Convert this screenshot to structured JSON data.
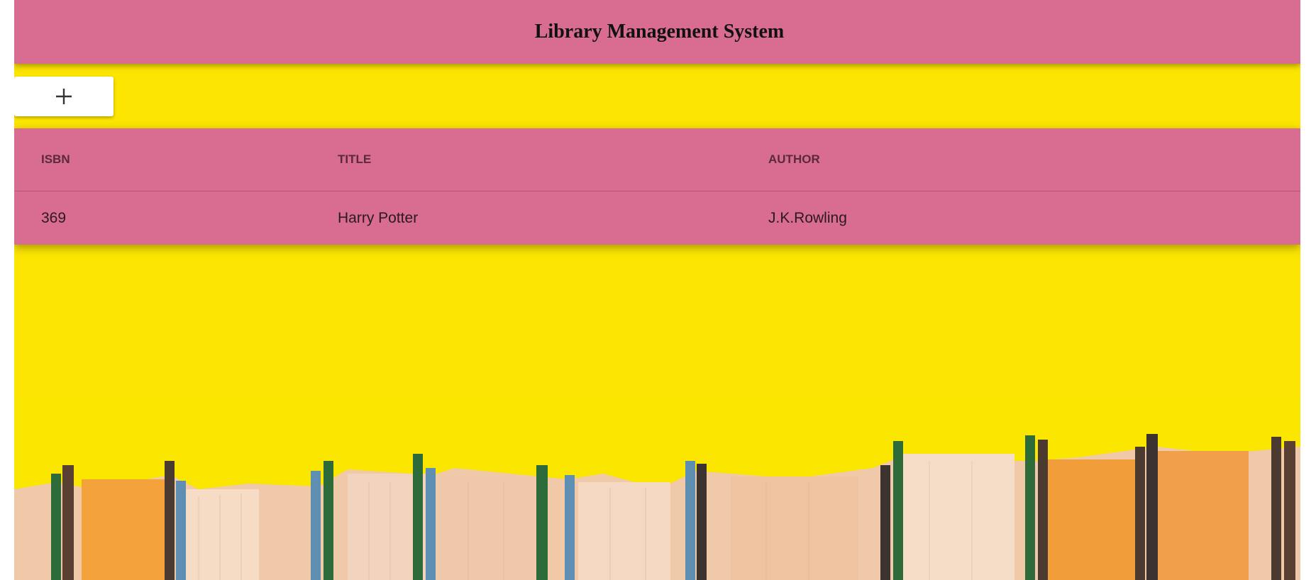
{
  "header": {
    "title": "Library Management System"
  },
  "toolbar": {
    "add_icon": "plus-icon"
  },
  "table": {
    "columns": [
      "ISBN",
      "TITLE",
      "AUTHOR"
    ],
    "rows": [
      {
        "isbn": "369",
        "title": "Harry Potter",
        "author": "J.K.Rowling"
      }
    ]
  },
  "colors": {
    "header_bg": "#d96d91",
    "page_bg": "#fbe600",
    "button_bg": "#ffffff"
  }
}
